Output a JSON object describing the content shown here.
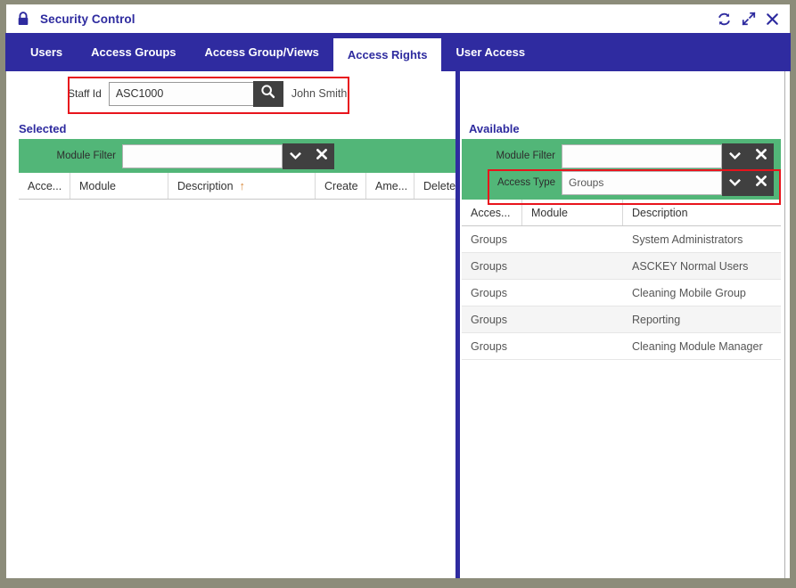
{
  "window": {
    "title": "Security Control",
    "icon": "lock-icon",
    "actions": [
      {
        "name": "refresh-icon",
        "glyph": "↻"
      },
      {
        "name": "expand-icon",
        "glyph": "↗"
      },
      {
        "name": "close-icon",
        "glyph": "✖"
      }
    ]
  },
  "tabs": [
    {
      "label": "Users",
      "active": false
    },
    {
      "label": "Access Groups",
      "active": false
    },
    {
      "label": "Access Group/Views",
      "active": false
    },
    {
      "label": "Access Rights",
      "active": true
    },
    {
      "label": "User Access",
      "active": false
    }
  ],
  "staff_search": {
    "label": "Staff Id",
    "value": "ASC1000",
    "placeholder": "",
    "search_icon": "search-icon",
    "staff_name": "John  Smith"
  },
  "selected_panel": {
    "title": "Selected",
    "filters": [
      {
        "label": "Module Filter",
        "value": "",
        "placeholder": ""
      }
    ],
    "columns": [
      {
        "label": "Acce...",
        "sorted": false
      },
      {
        "label": "Module",
        "sorted": false
      },
      {
        "label": "Description",
        "sorted": true,
        "sort_dir": "↑"
      },
      {
        "label": "Create",
        "sorted": false
      },
      {
        "label": "Ame...",
        "sorted": false
      },
      {
        "label": "Delete",
        "sorted": false
      }
    ],
    "rows": []
  },
  "available_panel": {
    "title": "Available",
    "filters": [
      {
        "label": "Module Filter",
        "value": "",
        "placeholder": ""
      },
      {
        "label": "Access Type",
        "value": "Groups",
        "placeholder": ""
      }
    ],
    "columns": [
      {
        "label": "Acces...",
        "sorted": false
      },
      {
        "label": "Module",
        "sorted": false
      },
      {
        "label": "Description",
        "sorted": false
      }
    ],
    "rows": [
      {
        "access": "Groups",
        "module": "",
        "description": "System Administrators"
      },
      {
        "access": "Groups",
        "module": "",
        "description": "ASCKEY Normal Users"
      },
      {
        "access": "Groups",
        "module": "",
        "description": "Cleaning Mobile Group"
      },
      {
        "access": "Groups",
        "module": "",
        "description": "Reporting"
      },
      {
        "access": "Groups",
        "module": "",
        "description": "Cleaning Module Manager"
      }
    ]
  },
  "colors": {
    "brand_blue": "#2f2ba0",
    "title_text": "#2e2b9f",
    "filter_green": "#52b678",
    "button_dark": "#404040",
    "highlight_red": "#e8141c",
    "frame_gray": "#8c8c7a"
  }
}
